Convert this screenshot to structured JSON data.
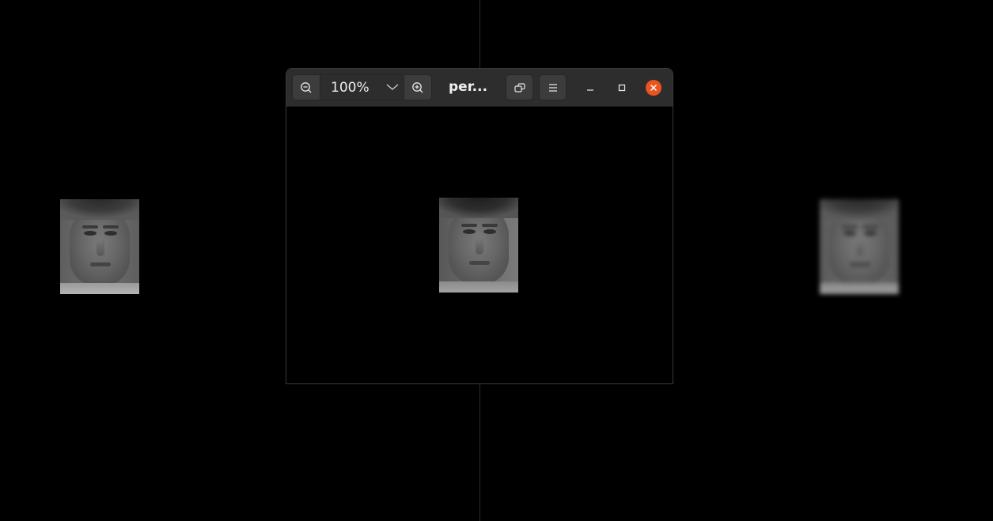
{
  "window": {
    "title": "per...",
    "zoom_level": "100%"
  },
  "icons": {
    "zoom_out": "zoom-out-icon",
    "zoom_in": "zoom-in-icon",
    "zoom_dropdown": "chevron-down-icon",
    "rotate": "rotate-icon",
    "menu": "hamburger-menu-icon",
    "minimize": "minimize-icon",
    "maximize": "maximize-icon",
    "close": "close-icon"
  },
  "colors": {
    "close_button": "#e95420",
    "headerbar": "#2d2d2d",
    "background": "#000000"
  }
}
